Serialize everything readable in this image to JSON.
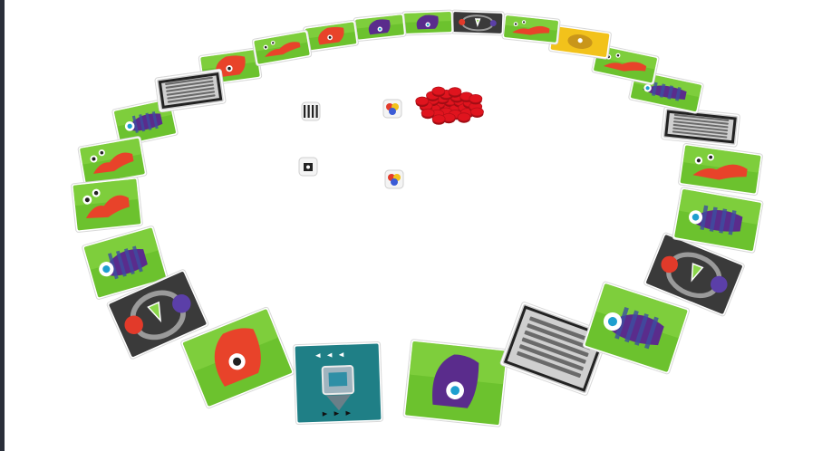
{
  "scene": {
    "background": "#ffffff",
    "colors": {
      "green_card": "#6cc22e",
      "green_card_light": "#8fd94a",
      "grey_card": "#3a3a3a",
      "teal_card": "#1f7f86",
      "vent_card": "#cfcfcf",
      "red_token": "#e0141e",
      "monster_red": "#e8432a",
      "monster_purple": "#5a2c8c",
      "monster_stripe": "#3c4fa0",
      "yellow_card": "#f2c21b",
      "maroon_card": "#8a1c1c"
    },
    "cards": [
      {
        "kind": "monster",
        "icon": "purple-striped-monster-icon"
      },
      {
        "kind": "vent",
        "icon": "vent-grate-icon"
      },
      {
        "kind": "monster",
        "icon": "red-tall-monster-icon"
      },
      {
        "kind": "monster",
        "icon": "red-slug-monster-icon"
      },
      {
        "kind": "monster",
        "icon": "red-slug-monster-icon"
      },
      {
        "kind": "monster",
        "icon": "purple-striped-monster-icon"
      },
      {
        "kind": "swap",
        "icon": "color-swap-icon"
      },
      {
        "kind": "monster",
        "icon": "red-tall-monster-icon"
      },
      {
        "kind": "robot",
        "icon": "robot-icon"
      },
      {
        "kind": "monster",
        "icon": "purple-tall-monster-icon"
      },
      {
        "kind": "vent",
        "icon": "vent-grate-icon"
      },
      {
        "kind": "monster",
        "icon": "purple-striped-monster-icon"
      },
      {
        "kind": "swap",
        "icon": "color-swap-icon"
      },
      {
        "kind": "monster",
        "icon": "purple-striped-monster-icon"
      },
      {
        "kind": "monster",
        "icon": "red-slug-monster-icon"
      },
      {
        "kind": "vent",
        "icon": "vent-grate-icon"
      },
      {
        "kind": "monster",
        "icon": "purple-striped-monster-icon"
      },
      {
        "kind": "monster",
        "icon": "red-slug-monster-icon"
      },
      {
        "kind": "special",
        "icon": "yellow-monster-icon"
      },
      {
        "kind": "monster",
        "icon": "red-slug-monster-icon"
      },
      {
        "kind": "special",
        "icon": "grey-swap-icon"
      },
      {
        "kind": "monster",
        "icon": "purple-small-monster-icon"
      },
      {
        "kind": "monster",
        "icon": "purple-small-monster-icon"
      },
      {
        "kind": "special",
        "icon": "maroon-robot-icon"
      },
      {
        "kind": "monster",
        "icon": "red-small-monster-icon"
      },
      {
        "kind": "monster",
        "icon": "red-slug-monster-icon"
      },
      {
        "kind": "vent",
        "icon": "vent-grate-icon"
      }
    ],
    "dice": [
      {
        "icon": "pattern-die-icon"
      },
      {
        "icon": "color-die-icon"
      },
      {
        "icon": "number-die-icon"
      },
      {
        "icon": "color-die-icon"
      }
    ],
    "tokens": {
      "count": 30,
      "icon": "red-token-icon"
    }
  }
}
